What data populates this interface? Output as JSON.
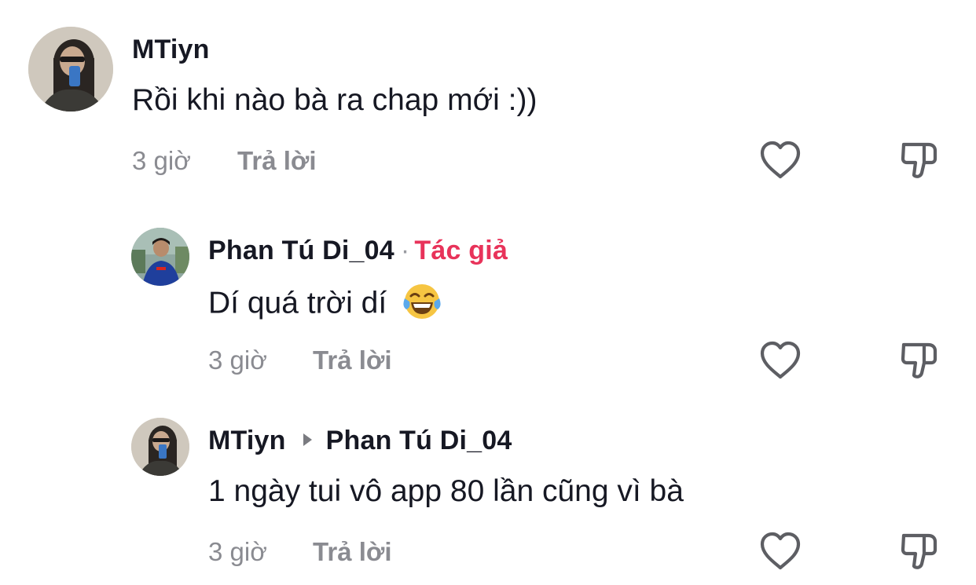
{
  "comments": [
    {
      "username": "MTiyn",
      "text": "Rồi khi nào bà ra chap mới :))",
      "time": "3 giờ",
      "reply_label": "Trả lời"
    },
    {
      "username": "Phan Tú Di_04",
      "badge_separator": "·",
      "badge": "Tác giả",
      "text": "Dí quá trời dí",
      "emoji": "face-with-tears-of-joy",
      "time": "3 giờ",
      "reply_label": "Trả lời"
    },
    {
      "username": "MTiyn",
      "reply_to": "Phan Tú Di_04",
      "text": "1 ngày tui vô app 80 lần cũng vì bà",
      "time": "3 giờ",
      "reply_label": "Trả lời"
    }
  ],
  "icons": {
    "like": "heart-outline-icon",
    "dislike": "thumbs-down-outline-icon",
    "reply_to_arrow": "triangle-right-icon"
  },
  "colors": {
    "author_badge": "#e8335a",
    "secondary_text": "#8a8b91",
    "primary_text": "#161823"
  }
}
